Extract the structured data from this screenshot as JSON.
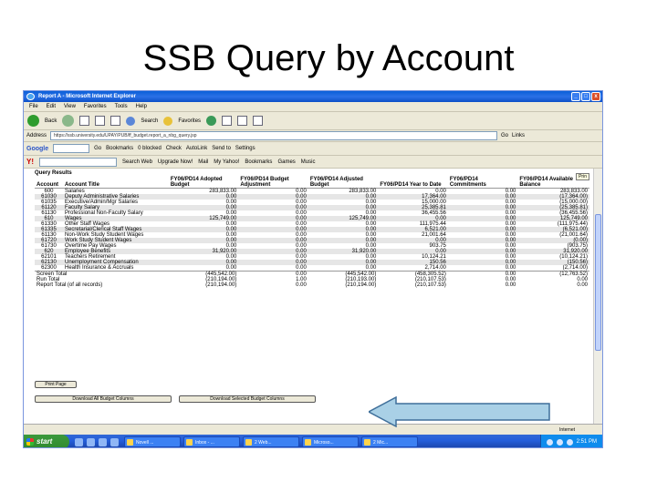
{
  "slide": {
    "title": "SSB Query by Account"
  },
  "window": {
    "title": "Report A - Microsoft Internet Explorer",
    "buttons": [
      "_",
      "□",
      "x"
    ]
  },
  "menu": [
    "File",
    "Edit",
    "View",
    "Favorites",
    "Tools",
    "Help"
  ],
  "toolbar": {
    "back": "Back",
    "search": "Search",
    "favorites": "Favorites"
  },
  "address": {
    "label": "Address",
    "url": "https://ssb.university.edu/UPAY/PUB/ff_budget.report_a_nbg_query.jsp",
    "go": "Go",
    "links": "Links"
  },
  "google": {
    "logo": "Google",
    "go": "G",
    "items": [
      "Go",
      "Bookmarks",
      "0 blocked",
      "Check",
      "AutoLink",
      "Send to",
      "Settings"
    ]
  },
  "yahoo": {
    "logo": "Y!",
    "items": [
      "Search Web",
      "Upgrade Now!",
      "Mail",
      "My Yahoo!",
      "Bookmarks",
      "Games",
      "Music"
    ]
  },
  "query": {
    "label": "Query Results",
    "prompt": "Prin",
    "headers": [
      "Account",
      "Account Title",
      "FY06/PD14 Adopted Budget",
      "FY06/PD14 Budget Adjustment",
      "FY06/PD14 Adjusted Budget",
      "FY06/PD14 Year to Date",
      "FY06/PD14 Commitments",
      "FY06/PD14 Available Balance"
    ],
    "rows": [
      [
        "600",
        "Salaries",
        "283,833.00",
        "0.00",
        "283,833.00",
        "0.00",
        "0.00",
        "283,833.00"
      ],
      [
        "61030",
        "Deputy Administrative Salaries",
        "0.00",
        "0.00",
        "0.00",
        "17,364.00",
        "0.00",
        "(17,364.00)"
      ],
      [
        "61035",
        "Executive/Admin/Mgr Salaries",
        "0.00",
        "0.00",
        "0.00",
        "15,000.00",
        "0.00",
        "(15,000.00)"
      ],
      [
        "61120",
        "Faculty Salary",
        "0.00",
        "0.00",
        "0.00",
        "25,385.81",
        "0.00",
        "(25,385.81)"
      ],
      [
        "61130",
        "Professional Non-Faculty Salary",
        "0.00",
        "0.00",
        "0.00",
        "36,455.56",
        "0.00",
        "(36,455.56)"
      ],
      [
        "610",
        "Wages",
        "125,749.00",
        "0.00",
        "125,749.00",
        "0.00",
        "0.00",
        "125,749.00"
      ],
      [
        "61330",
        "Other Staff Wages",
        "0.00",
        "0.00",
        "0.00",
        "111,975.44",
        "0.00",
        "(111,975.44)"
      ],
      [
        "61335",
        "Secretarial/Clerical Staff Wages",
        "0.00",
        "0.00",
        "0.00",
        "6,521.00",
        "0.00",
        "(6,521.00)"
      ],
      [
        "61130",
        "Non-Work Study Student Wages",
        "0.00",
        "0.00",
        "0.00",
        "21,001.64",
        "0.00",
        "(21,001.64)"
      ],
      [
        "61720",
        "Work Study Student Wages",
        "0.00",
        "0.00",
        "0.00",
        "0.00",
        "0.00",
        "(0.00)"
      ],
      [
        "61730",
        "Overtime Pay Wages",
        "0.00",
        "0.00",
        "0.00",
        "903.75",
        "0.00",
        "(903.75)"
      ],
      [
        "620",
        "Employee Benefits",
        "31,920.00",
        "0.00",
        "31,920.00",
        "0.00",
        "0.00",
        "31,920.00"
      ],
      [
        "62101",
        "Teachers Retirement",
        "0.00",
        "0.00",
        "0.00",
        "10,124.21",
        "0.00",
        "(10,124.21)"
      ],
      [
        "62130",
        "Unemployment Compensation",
        "0.00",
        "0.00",
        "0.00",
        "150.56",
        "0.00",
        "(150.56)"
      ],
      [
        "62300",
        "Health Insurance & Accruals",
        "0.00",
        "0.00",
        "0.00",
        "2,714.00",
        "0.00",
        "(2,714.00)"
      ]
    ],
    "totals": [
      [
        "Screen Total",
        "(445,542.00)",
        "0.00",
        "(445,542.00)",
        "(458,305.52)",
        "0.00",
        "(12,763.52)"
      ],
      [
        "Run Total",
        "(210,194.00)",
        "1.00",
        "(210,193.00)",
        "(210,107.53)",
        "0.00",
        "0.00"
      ],
      [
        "Report Total (of all records)",
        "(210,194.00)",
        "0.00",
        "(210,194.00)",
        "(210,107.53)",
        "0.00",
        "0.00"
      ]
    ],
    "buttons": {
      "print": "Print Page",
      "download_all": "Download All Budget Columns",
      "download_selected": "Download Selected Budget Columns"
    }
  },
  "status": {
    "zone": "Internet"
  },
  "taskbar": {
    "start": "start",
    "tasks": [
      "Novell ...",
      "Inbox - ...",
      "2 Web...",
      "Microso...",
      "2 Mic..."
    ],
    "clock": "2:51 PM"
  },
  "colors": {
    "arrow_fill": "#a9d0e6",
    "arrow_stroke": "#3f6f9a",
    "titlebar": "#0a5fd8",
    "taskbar": "#245edb"
  }
}
